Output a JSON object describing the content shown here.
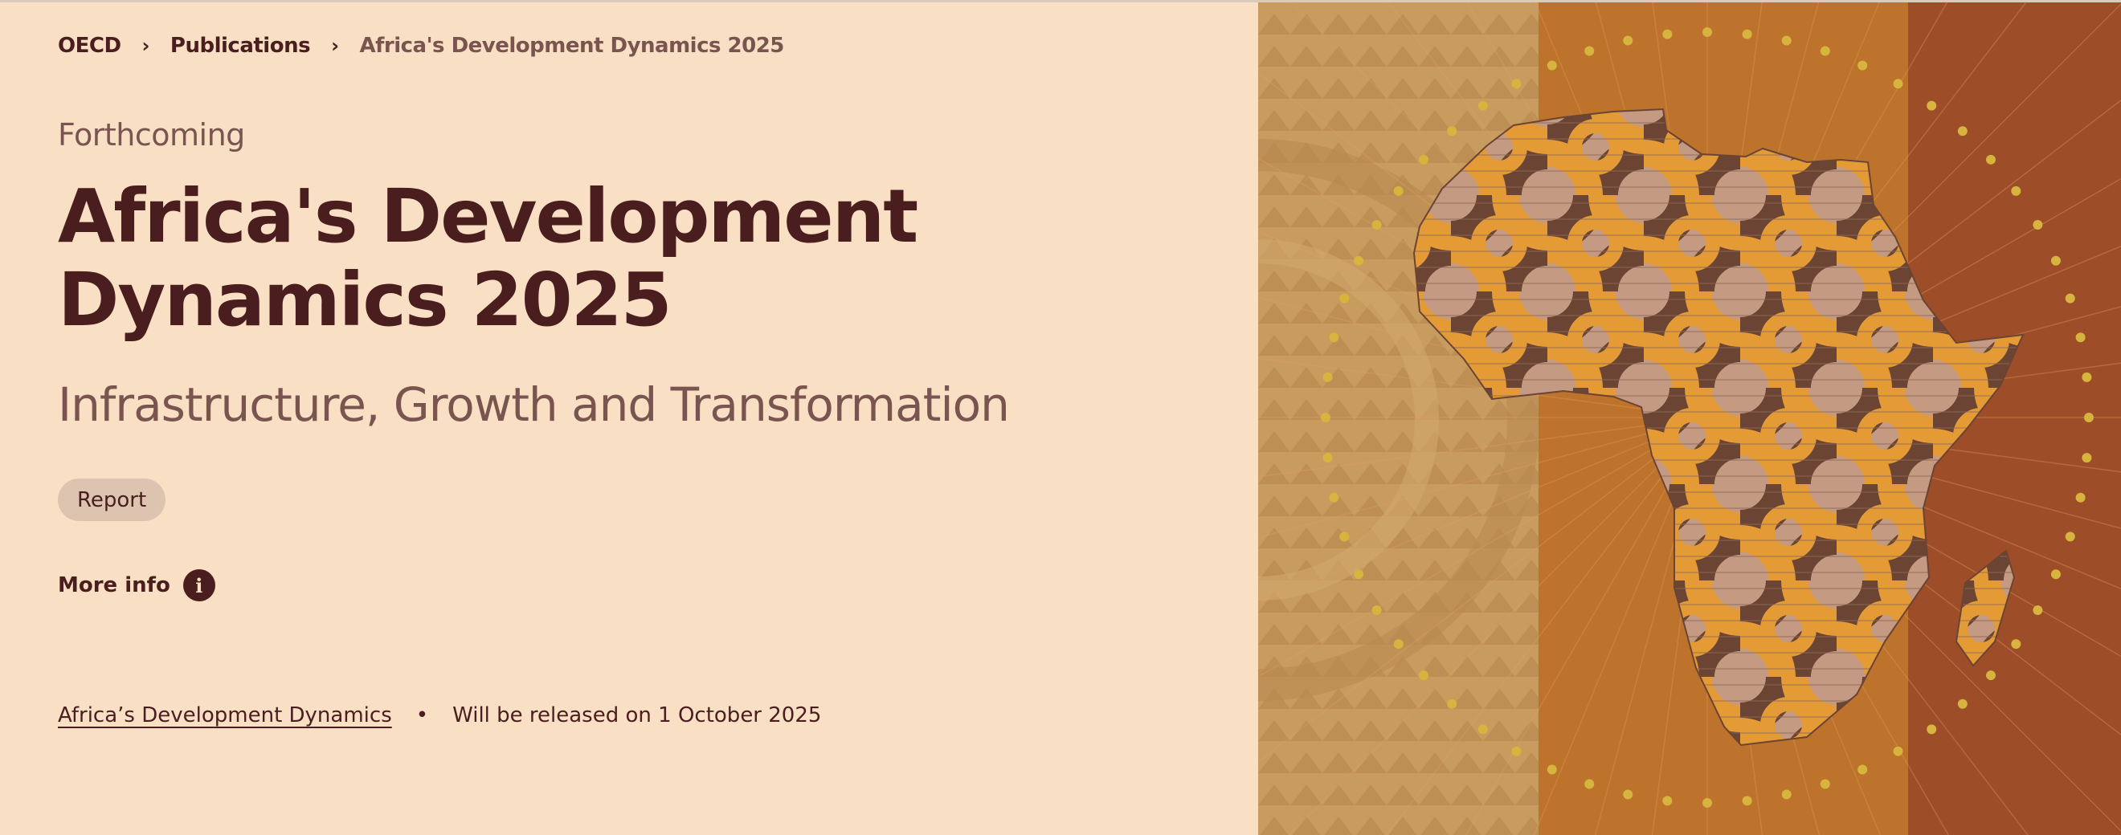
{
  "breadcrumb": {
    "items": [
      {
        "label": "OECD"
      },
      {
        "label": "Publications"
      },
      {
        "label": "Africa's Development Dynamics 2025"
      }
    ],
    "separator_icon": "chevron-right-icon"
  },
  "publication": {
    "status": "Forthcoming",
    "title_line1": "Africa's Development",
    "title_line2": "Dynamics 2025",
    "subtitle": "Infrastructure, Growth and Transformation",
    "type_badge": "Report",
    "more_info_label": "More info",
    "more_info_icon": "info-icon",
    "series_link": "Africa’s Development Dynamics",
    "bullet": "•",
    "release_text": "Will be released on 1 October 2025"
  },
  "cover_image": {
    "subject": "Stylized patterned map of Africa on tan, orange and rust bands",
    "colors": {
      "band_left": "#c89c5f",
      "band_middle": "#bd732b",
      "band_right": "#9d4d28",
      "dots": "#d6b43e",
      "map_dark": "#6b4433",
      "map_orange": "#e59b35",
      "map_tan": "#c49a82"
    }
  },
  "colors": {
    "background": "#f9dfc3",
    "text_dark": "#4a1d1f",
    "text_muted": "#7a5550",
    "badge_bg": "#dcc4b0"
  }
}
